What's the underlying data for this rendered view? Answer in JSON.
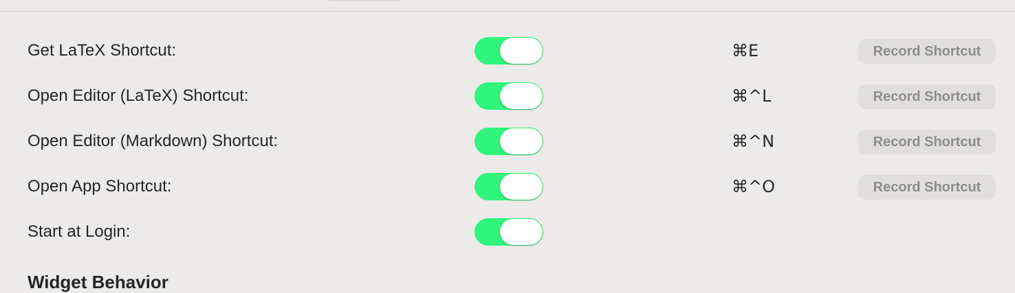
{
  "settings": {
    "rows": [
      {
        "label": "Get LaTeX Shortcut:",
        "enabled": true,
        "shortcut": "⌘E",
        "record_label": "Record Shortcut"
      },
      {
        "label": "Open Editor (LaTeX) Shortcut:",
        "enabled": true,
        "shortcut": "⌘^L",
        "record_label": "Record Shortcut"
      },
      {
        "label": "Open Editor (Markdown) Shortcut:",
        "enabled": true,
        "shortcut": "⌘^N",
        "record_label": "Record Shortcut"
      },
      {
        "label": "Open App Shortcut:",
        "enabled": true,
        "shortcut": "⌘^O",
        "record_label": "Record Shortcut"
      },
      {
        "label": "Start at Login:",
        "enabled": true
      }
    ],
    "next_section_title": "Widget Behavior"
  },
  "colors": {
    "toggle_on": "#2ff57a",
    "background": "#ecebe9",
    "button_bg": "#e0dfdd",
    "button_text": "#8e8d8b"
  }
}
